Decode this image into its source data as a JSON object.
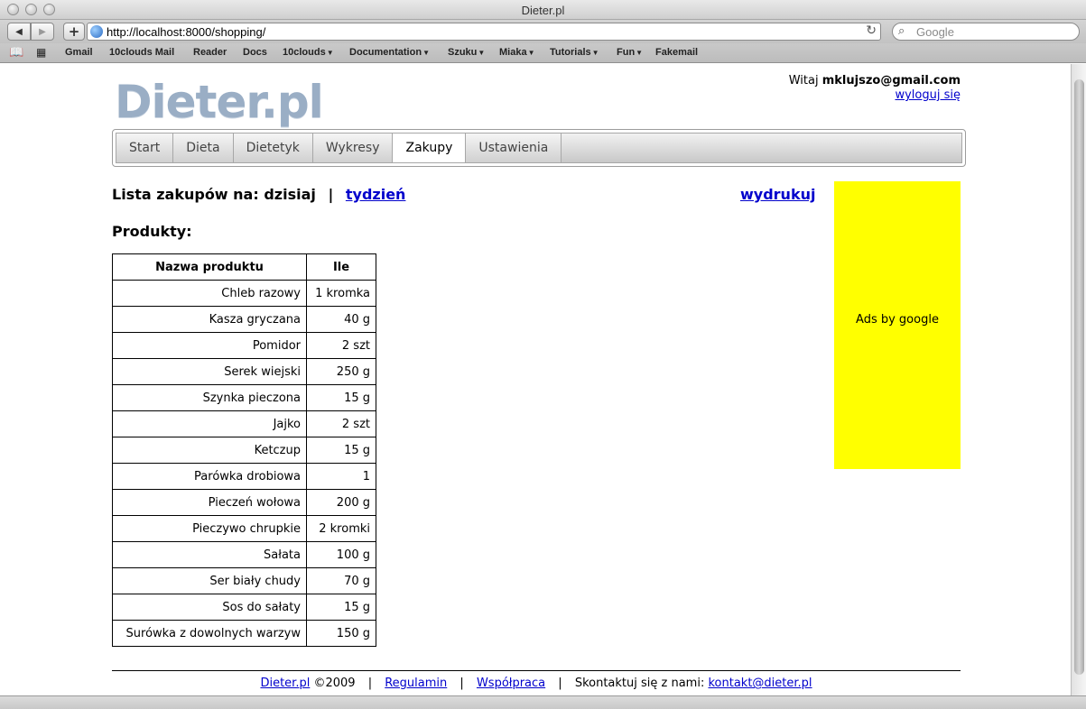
{
  "browser": {
    "window_title": "Dieter.pl",
    "url": "http://localhost:8000/shopping/",
    "search_placeholder": "Google",
    "bookmarks": [
      {
        "label": "Gmail",
        "menu": false
      },
      {
        "label": "10clouds Mail",
        "menu": false
      },
      {
        "label": "Reader",
        "menu": false
      },
      {
        "label": "Docs",
        "menu": false
      },
      {
        "label": "10clouds",
        "menu": true
      },
      {
        "label": "Documentation",
        "menu": true
      },
      {
        "label": "Szuku",
        "menu": true
      },
      {
        "label": "Miaka",
        "menu": true
      },
      {
        "label": "Tutorials",
        "menu": true
      },
      {
        "label": "Fun",
        "menu": true
      },
      {
        "label": "Fakemail",
        "menu": false
      }
    ]
  },
  "header": {
    "logo": "Dieter.pl",
    "welcome_prefix": "Witaj",
    "user_email": "mklujszo@gmail.com",
    "logout": "wyloguj się"
  },
  "tabs": [
    {
      "label": "Start",
      "active": false
    },
    {
      "label": "Dieta",
      "active": false
    },
    {
      "label": "Dietetyk",
      "active": false
    },
    {
      "label": "Wykresy",
      "active": false
    },
    {
      "label": "Zakupy",
      "active": true
    },
    {
      "label": "Ustawienia",
      "active": false
    }
  ],
  "main": {
    "heading_prefix": "Lista zakupów na: dzisiaj",
    "heading_sep": "|",
    "week_link": "tydzień",
    "print_link": "wydrukuj",
    "products_label": "Produkty:",
    "table": {
      "headers": [
        "Nazwa produktu",
        "Ile"
      ],
      "rows": [
        {
          "name": "Chleb razowy",
          "qty": "1 kromka"
        },
        {
          "name": "Kasza gryczana",
          "qty": "40 g"
        },
        {
          "name": "Pomidor",
          "qty": "2 szt"
        },
        {
          "name": "Serek wiejski",
          "qty": "250 g"
        },
        {
          "name": "Szynka pieczona",
          "qty": "15 g"
        },
        {
          "name": "Jajko",
          "qty": "2 szt"
        },
        {
          "name": "Ketczup",
          "qty": "15 g"
        },
        {
          "name": "Parówka drobiowa",
          "qty": "1"
        },
        {
          "name": "Pieczeń wołowa",
          "qty": "200 g"
        },
        {
          "name": "Pieczywo chrupkie",
          "qty": "2 kromki"
        },
        {
          "name": "Sałata",
          "qty": "100 g"
        },
        {
          "name": "Ser biały chudy",
          "qty": "70 g"
        },
        {
          "name": "Sos do sałaty",
          "qty": "15 g"
        },
        {
          "name": "Surówka z dowolnych warzyw",
          "qty": "150 g"
        }
      ]
    }
  },
  "ad": {
    "text": "Ads by google",
    "color": "#ffff00"
  },
  "footer": {
    "site_link": "Dieter.pl",
    "copyright": "©2009",
    "terms": "Regulamin",
    "cooperation": "Współpraca",
    "contact_prefix": "Skontaktuj się z nami:",
    "contact_email": "kontakt@dieter.pl"
  },
  "colors": {
    "link": "#0000cc",
    "logo": "#9aaec5"
  }
}
